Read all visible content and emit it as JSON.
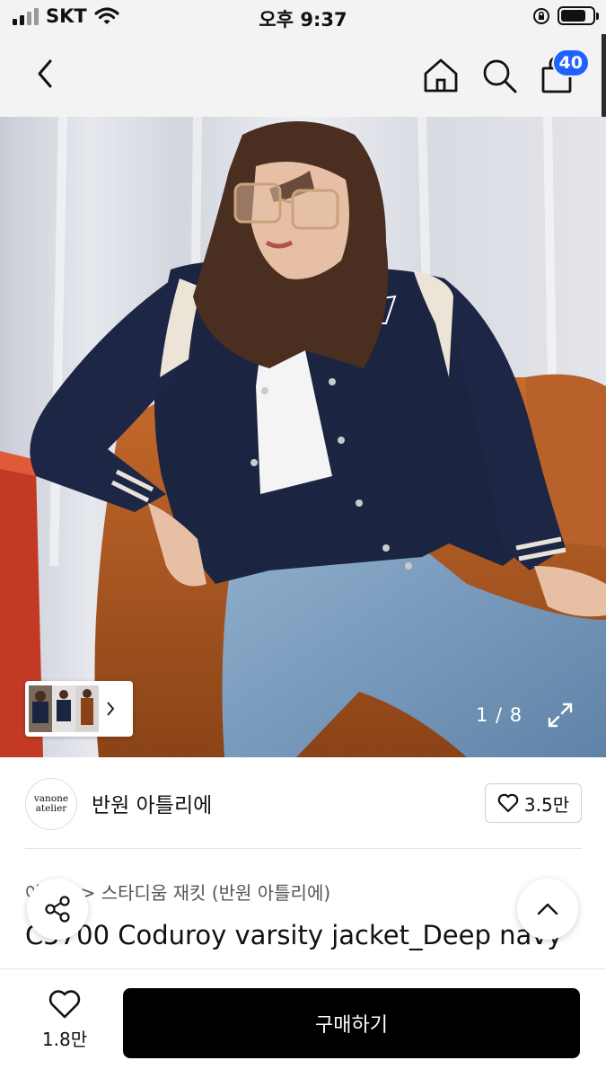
{
  "status_bar": {
    "carrier": "SKT",
    "time": "오후 9:37"
  },
  "nav": {
    "cart_count": "40",
    "icons": [
      "chevron-left-icon",
      "home-icon",
      "search-icon",
      "shopping-bag-icon"
    ]
  },
  "gallery": {
    "page_counter": "1 / 8",
    "current_page": 1,
    "total_pages": 8
  },
  "store": {
    "logo_line1": "vanone",
    "logo_line2": "atelier",
    "name": "반원 아틀리에",
    "likes": "3.5만"
  },
  "product": {
    "breadcrumb_parent": "아우터",
    "breadcrumb_separator": ">",
    "breadcrumb_current": "스타디움 재킷 (반원 아틀리에)",
    "title": "C5700 Coduroy varsity jacket_Deep navy"
  },
  "bottom_bar": {
    "wish_count": "1.8만",
    "buy_label": "구매하기"
  },
  "colors": {
    "badge": "#1e63ff",
    "buy_button": "#000000"
  }
}
